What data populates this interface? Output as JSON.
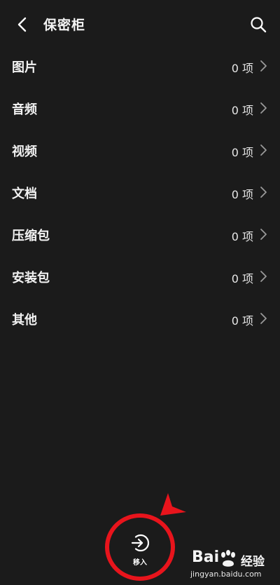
{
  "header": {
    "title": "保密柜",
    "back_icon": "chevron-left-icon",
    "search_icon": "search-icon"
  },
  "categories": [
    {
      "label": "图片",
      "count": "0 项"
    },
    {
      "label": "音频",
      "count": "0 项"
    },
    {
      "label": "视频",
      "count": "0 项"
    },
    {
      "label": "文档",
      "count": "0 项"
    },
    {
      "label": "压缩包",
      "count": "0 项"
    },
    {
      "label": "安装包",
      "count": "0 项"
    },
    {
      "label": "其他",
      "count": "0 项"
    }
  ],
  "bottom_action": {
    "label": "移入",
    "icon": "move-in-icon"
  },
  "watermark": {
    "brand": "Bai",
    "brand_cn": "经验",
    "url": "jingyan.baidu.com"
  },
  "colors": {
    "background": "#1b1b1b",
    "text": "#ffffff",
    "annotation": "#e8141c"
  }
}
